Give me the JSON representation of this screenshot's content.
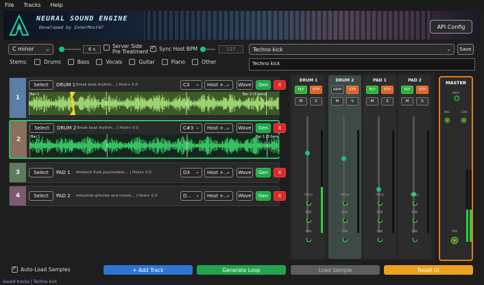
{
  "menu": [
    "File",
    "Tracks",
    "Help"
  ],
  "banner": {
    "title": "NEURAL SOUND ENGINE",
    "subtitle": "Developed by InnerMost47",
    "api_button": "API Config"
  },
  "controls": {
    "key": "C minor",
    "length_value": "6 s",
    "server_side_label_1": "Server Side",
    "server_side_label_2": "Pre Treatment",
    "sync_label": "Sync Host BPM",
    "sync_checked": true,
    "bpm_value": "127",
    "preset": "Techno kick",
    "save_label": "Save",
    "prompt": "Techno kick"
  },
  "stems": {
    "label": "Stems:",
    "items": [
      "Drums",
      "Bass",
      "Vocals",
      "Guitar",
      "Piano",
      "Other"
    ]
  },
  "tracks": [
    {
      "num": "1",
      "select": "Select",
      "name": "DRUM 1",
      "desc": "Break beat rhythm... | Host+ 0.0",
      "key": "C3",
      "host": "Host +...",
      "wave": "Wave",
      "gen": "Gen",
      "del": "X",
      "bar1": "Bar 1",
      "bar2": "Bar 2 (3 bars)",
      "bar2b": "Bar 2 (3 bars)"
    },
    {
      "num": "2",
      "select": "Select",
      "name": "DRUM 2",
      "desc": "Break beat rhythm... | Host+ 0.0",
      "key": "C#3",
      "host": "Host +...",
      "wave": "Wave",
      "gen": "Gen",
      "del": "X",
      "bar1": "Bar 1",
      "bar2": "Bar 1 (3 bars)"
    },
    {
      "num": "3",
      "select": "Select",
      "name": "PAD 1",
      "desc": "Ambient flute psychedelic... | Host+ 0.0",
      "key": "D3",
      "host": "Host +...",
      "wave": "Wave",
      "gen": "Gen",
      "del": "X"
    },
    {
      "num": "4",
      "select": "Select",
      "name": "PAD 2",
      "desc": "Industrial glitches and noises... | Host+ 0.0",
      "key": "D...",
      "host": "Host +...",
      "wave": "Wave",
      "gen": "Gen",
      "del": "X"
    }
  ],
  "mixer": {
    "strips": [
      {
        "name": "DRUM 1",
        "b1": "PLY",
        "b2": "STP",
        "m": "M",
        "s": "S",
        "fader_level": 0.8,
        "meter_level": 0.45
      },
      {
        "name": "DRUM 2",
        "b1": "ARM",
        "b2": "STP",
        "m": "M",
        "s": "S",
        "fader_level": 0.75,
        "meter_level": 0.0
      },
      {
        "name": "PAD 1",
        "b1": "PLY",
        "b2": "STP",
        "m": "M",
        "s": "S",
        "fader_level": 0.45,
        "meter_level": 0.0
      },
      {
        "name": "PAD 2",
        "b1": "PLY",
        "b2": "STP",
        "m": "M",
        "s": "S",
        "fader_level": 0.4,
        "meter_level": 0.0
      }
    ],
    "knob_labels": [
      "PITCH",
      "RISE",
      "PAN"
    ],
    "master": {
      "name": "MASTER",
      "high": "HIGH",
      "mid": "MID",
      "low": "LOW",
      "pan": "PAN"
    }
  },
  "bottom": {
    "auto_load": "Auto-Load Samples",
    "add_track": "+ Add Track",
    "generate": "Generate Loop",
    "load_sample": "Load Sample",
    "reset": "Reset UI"
  },
  "status": "Saved tracks | Techno kick",
  "colors": {
    "accent_green": "#16c47a",
    "gen_green": "#1fa84a",
    "delete_red": "#d82a2a",
    "reset_orange": "#f0a020",
    "add_blue": "#2f75d6",
    "master_border": "#e67a1e"
  }
}
